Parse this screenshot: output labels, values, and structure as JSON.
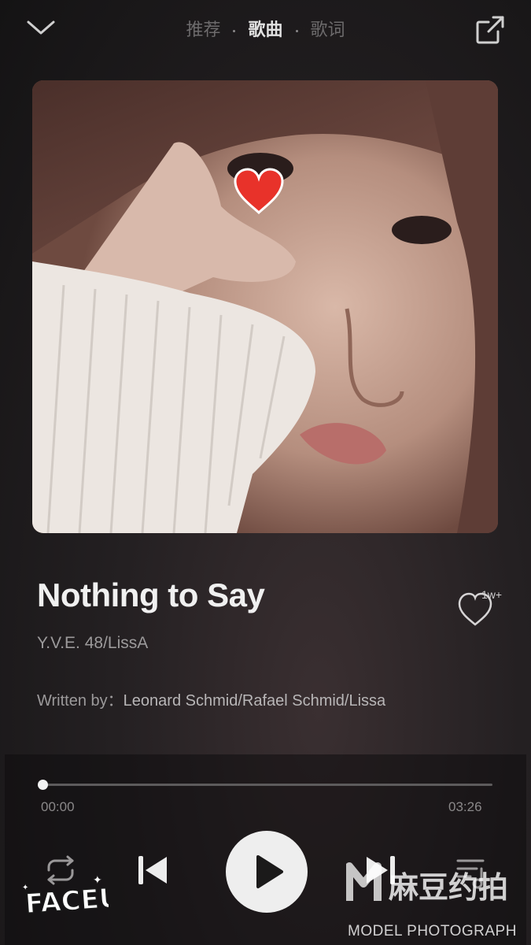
{
  "header": {
    "tabs": [
      {
        "label": "推荐",
        "active": false
      },
      {
        "label": "歌曲",
        "active": true
      },
      {
        "label": "歌词",
        "active": false
      }
    ],
    "icons": {
      "collapse": "chevron-down-icon",
      "share": "share-external-icon"
    }
  },
  "song": {
    "title": "Nothing to Say",
    "artist": "Y.V.E. 48/LissA",
    "written_by_label": "Written by：",
    "writers": "Leonard Schmid/Rafael Schmid/Lissa",
    "like_count": "1w+"
  },
  "player": {
    "current_time": "00:00",
    "total_time": "03:26",
    "progress": 0.0,
    "icons": {
      "repeat": "repeat-icon",
      "previous": "skip-previous-icon",
      "play": "play-icon",
      "next": "skip-next-icon",
      "playlist": "playlist-icon"
    }
  },
  "watermarks": {
    "faceu": "FACEU",
    "brand_cn": "麻豆约拍",
    "brand_en": "MODEL PHOTOGRAPH"
  },
  "colors": {
    "background": "#1c1a1b",
    "text_primary": "#f0f0f0",
    "text_secondary": "#9c9a9b",
    "accent_heart": "#e8322a",
    "play_button": "#eeeeee"
  }
}
